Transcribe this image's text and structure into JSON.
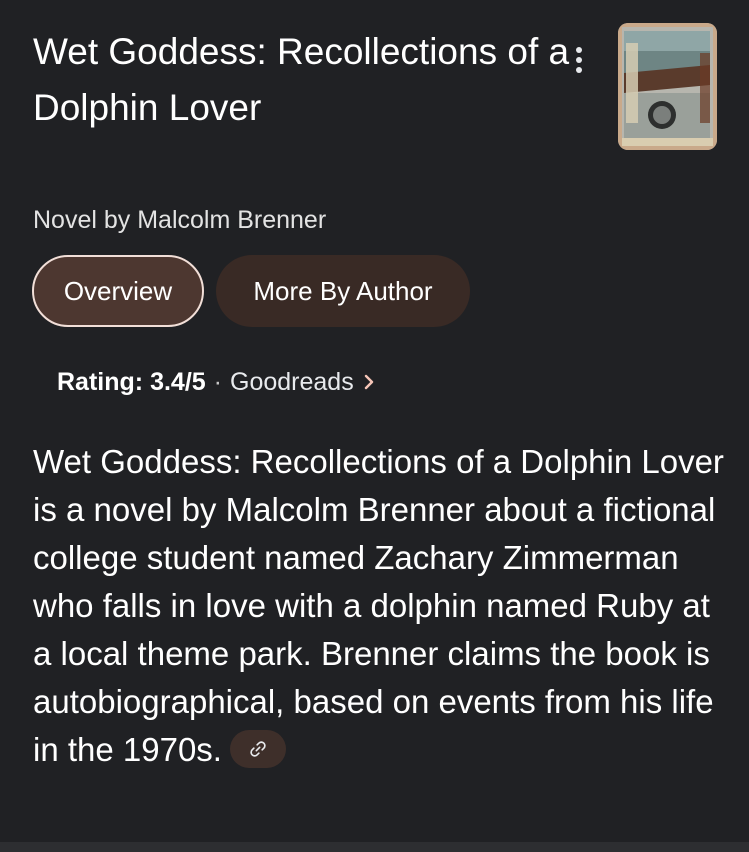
{
  "book": {
    "title": "Wet Goddess: Recollections of a Dolphin Lover",
    "subtitle": "Novel by Malcolm Brenner",
    "thumbnail_icon": "book-cover-image"
  },
  "tabs": [
    {
      "label": "Overview",
      "selected": true
    },
    {
      "label": "More By Author",
      "selected": false
    }
  ],
  "rating": {
    "label": "Rating:",
    "value": "3.4/5",
    "separator": "·",
    "source": "Goodreads"
  },
  "description": {
    "text": "Wet Goddess: Recollections of a Dolphin Lover is a novel by Malcolm Brenner about a fictional college student named Zachary Zimmerman who falls in love with a dolphin named Ruby at a local theme park. Brenner claims the book is autobiographical, based on events from his life in the 1970s."
  },
  "icons": {
    "more": "more-vert-icon",
    "chevron": "chevron-right-icon",
    "link": "link-icon"
  },
  "colors": {
    "background": "#202124",
    "chip_selected_bg": "#4d3730",
    "chip_selected_border": "#f2dfd8",
    "chip_bg": "#392a25",
    "accent_chevron": "#f6c6b8"
  }
}
